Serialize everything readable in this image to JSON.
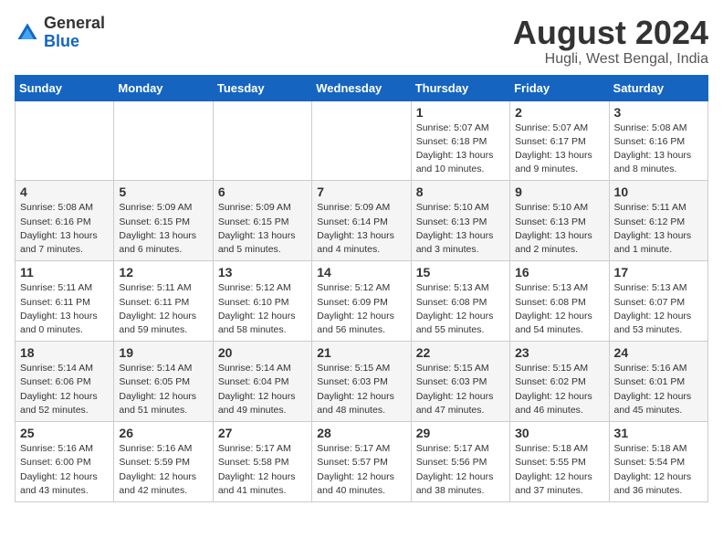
{
  "header": {
    "logo_general": "General",
    "logo_blue": "Blue",
    "month_year": "August 2024",
    "location": "Hugli, West Bengal, India"
  },
  "weekdays": [
    "Sunday",
    "Monday",
    "Tuesday",
    "Wednesday",
    "Thursday",
    "Friday",
    "Saturday"
  ],
  "weeks": [
    [
      {
        "day": "",
        "detail": ""
      },
      {
        "day": "",
        "detail": ""
      },
      {
        "day": "",
        "detail": ""
      },
      {
        "day": "",
        "detail": ""
      },
      {
        "day": "1",
        "detail": "Sunrise: 5:07 AM\nSunset: 6:18 PM\nDaylight: 13 hours\nand 10 minutes."
      },
      {
        "day": "2",
        "detail": "Sunrise: 5:07 AM\nSunset: 6:17 PM\nDaylight: 13 hours\nand 9 minutes."
      },
      {
        "day": "3",
        "detail": "Sunrise: 5:08 AM\nSunset: 6:16 PM\nDaylight: 13 hours\nand 8 minutes."
      }
    ],
    [
      {
        "day": "4",
        "detail": "Sunrise: 5:08 AM\nSunset: 6:16 PM\nDaylight: 13 hours\nand 7 minutes."
      },
      {
        "day": "5",
        "detail": "Sunrise: 5:09 AM\nSunset: 6:15 PM\nDaylight: 13 hours\nand 6 minutes."
      },
      {
        "day": "6",
        "detail": "Sunrise: 5:09 AM\nSunset: 6:15 PM\nDaylight: 13 hours\nand 5 minutes."
      },
      {
        "day": "7",
        "detail": "Sunrise: 5:09 AM\nSunset: 6:14 PM\nDaylight: 13 hours\nand 4 minutes."
      },
      {
        "day": "8",
        "detail": "Sunrise: 5:10 AM\nSunset: 6:13 PM\nDaylight: 13 hours\nand 3 minutes."
      },
      {
        "day": "9",
        "detail": "Sunrise: 5:10 AM\nSunset: 6:13 PM\nDaylight: 13 hours\nand 2 minutes."
      },
      {
        "day": "10",
        "detail": "Sunrise: 5:11 AM\nSunset: 6:12 PM\nDaylight: 13 hours\nand 1 minute."
      }
    ],
    [
      {
        "day": "11",
        "detail": "Sunrise: 5:11 AM\nSunset: 6:11 PM\nDaylight: 13 hours\nand 0 minutes."
      },
      {
        "day": "12",
        "detail": "Sunrise: 5:11 AM\nSunset: 6:11 PM\nDaylight: 12 hours\nand 59 minutes."
      },
      {
        "day": "13",
        "detail": "Sunrise: 5:12 AM\nSunset: 6:10 PM\nDaylight: 12 hours\nand 58 minutes."
      },
      {
        "day": "14",
        "detail": "Sunrise: 5:12 AM\nSunset: 6:09 PM\nDaylight: 12 hours\nand 56 minutes."
      },
      {
        "day": "15",
        "detail": "Sunrise: 5:13 AM\nSunset: 6:08 PM\nDaylight: 12 hours\nand 55 minutes."
      },
      {
        "day": "16",
        "detail": "Sunrise: 5:13 AM\nSunset: 6:08 PM\nDaylight: 12 hours\nand 54 minutes."
      },
      {
        "day": "17",
        "detail": "Sunrise: 5:13 AM\nSunset: 6:07 PM\nDaylight: 12 hours\nand 53 minutes."
      }
    ],
    [
      {
        "day": "18",
        "detail": "Sunrise: 5:14 AM\nSunset: 6:06 PM\nDaylight: 12 hours\nand 52 minutes."
      },
      {
        "day": "19",
        "detail": "Sunrise: 5:14 AM\nSunset: 6:05 PM\nDaylight: 12 hours\nand 51 minutes."
      },
      {
        "day": "20",
        "detail": "Sunrise: 5:14 AM\nSunset: 6:04 PM\nDaylight: 12 hours\nand 49 minutes."
      },
      {
        "day": "21",
        "detail": "Sunrise: 5:15 AM\nSunset: 6:03 PM\nDaylight: 12 hours\nand 48 minutes."
      },
      {
        "day": "22",
        "detail": "Sunrise: 5:15 AM\nSunset: 6:03 PM\nDaylight: 12 hours\nand 47 minutes."
      },
      {
        "day": "23",
        "detail": "Sunrise: 5:15 AM\nSunset: 6:02 PM\nDaylight: 12 hours\nand 46 minutes."
      },
      {
        "day": "24",
        "detail": "Sunrise: 5:16 AM\nSunset: 6:01 PM\nDaylight: 12 hours\nand 45 minutes."
      }
    ],
    [
      {
        "day": "25",
        "detail": "Sunrise: 5:16 AM\nSunset: 6:00 PM\nDaylight: 12 hours\nand 43 minutes."
      },
      {
        "day": "26",
        "detail": "Sunrise: 5:16 AM\nSunset: 5:59 PM\nDaylight: 12 hours\nand 42 minutes."
      },
      {
        "day": "27",
        "detail": "Sunrise: 5:17 AM\nSunset: 5:58 PM\nDaylight: 12 hours\nand 41 minutes."
      },
      {
        "day": "28",
        "detail": "Sunrise: 5:17 AM\nSunset: 5:57 PM\nDaylight: 12 hours\nand 40 minutes."
      },
      {
        "day": "29",
        "detail": "Sunrise: 5:17 AM\nSunset: 5:56 PM\nDaylight: 12 hours\nand 38 minutes."
      },
      {
        "day": "30",
        "detail": "Sunrise: 5:18 AM\nSunset: 5:55 PM\nDaylight: 12 hours\nand 37 minutes."
      },
      {
        "day": "31",
        "detail": "Sunrise: 5:18 AM\nSunset: 5:54 PM\nDaylight: 12 hours\nand 36 minutes."
      }
    ]
  ]
}
